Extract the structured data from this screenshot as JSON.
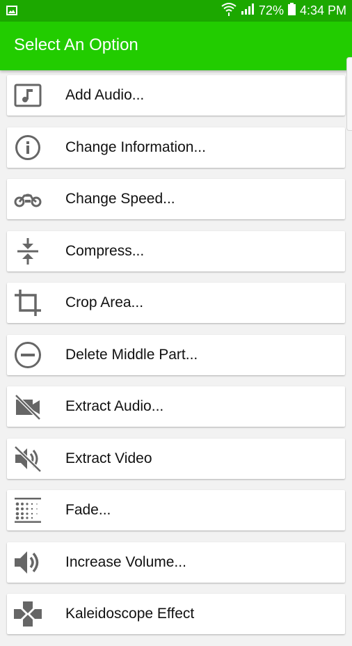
{
  "status_bar": {
    "battery_percent": "72%",
    "time": "4:34 PM"
  },
  "app_bar": {
    "title": "Select An Option"
  },
  "colors": {
    "status_bar": "#1ca800",
    "app_bar": "#22cc00",
    "icon": "#666666"
  },
  "options": [
    {
      "label": "Add Audio...",
      "icon": "music-note-icon"
    },
    {
      "label": "Change Information...",
      "icon": "info-icon"
    },
    {
      "label": "Change Speed...",
      "icon": "motorcycle-icon"
    },
    {
      "label": "Compress...",
      "icon": "compress-icon"
    },
    {
      "label": "Crop Area...",
      "icon": "crop-icon"
    },
    {
      "label": "Delete Middle Part...",
      "icon": "remove-circle-icon"
    },
    {
      "label": "Extract Audio...",
      "icon": "video-off-icon"
    },
    {
      "label": "Extract Video",
      "icon": "volume-off-icon"
    },
    {
      "label": "Fade...",
      "icon": "fade-icon"
    },
    {
      "label": "Increase Volume...",
      "icon": "volume-up-icon"
    },
    {
      "label": "Kaleidoscope Effect",
      "icon": "gamepad-icon"
    }
  ]
}
